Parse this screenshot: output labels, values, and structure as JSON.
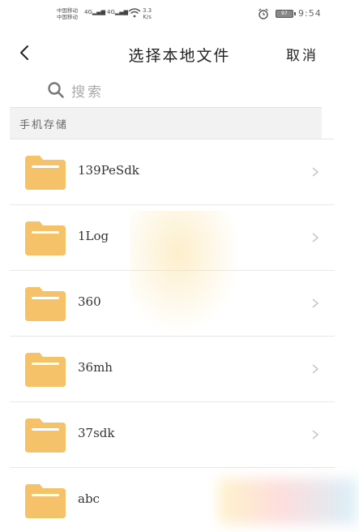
{
  "status_bar": {
    "carrier_line1": "中国移动",
    "carrier_line2": "中国移动",
    "signal1": "4G",
    "signal2": "4G",
    "speed_value": "3.3",
    "speed_unit": "K/s",
    "battery": "97",
    "time": "9:54",
    "icons": [
      "signal-icon",
      "wifi-icon",
      "alarm-icon",
      "battery-icon"
    ]
  },
  "header": {
    "back_icon": "chevron-left-icon",
    "title": "选择本地文件",
    "cancel_label": "取消"
  },
  "search": {
    "icon": "search-icon",
    "placeholder": "搜索"
  },
  "section": {
    "label": "手机存储"
  },
  "files": [
    {
      "name": "139PeSdk",
      "icon": "folder-icon"
    },
    {
      "name": "1Log",
      "icon": "folder-icon"
    },
    {
      "name": "360",
      "icon": "folder-icon"
    },
    {
      "name": "36mh",
      "icon": "folder-icon"
    },
    {
      "name": "37sdk",
      "icon": "folder-icon"
    },
    {
      "name": "abc",
      "icon": "folder-icon"
    }
  ],
  "colors": {
    "folder": "#f5c169",
    "folder_tab": "#f2b95a",
    "chevron": "#c8c8c8",
    "divider": "#e8e8e8"
  }
}
